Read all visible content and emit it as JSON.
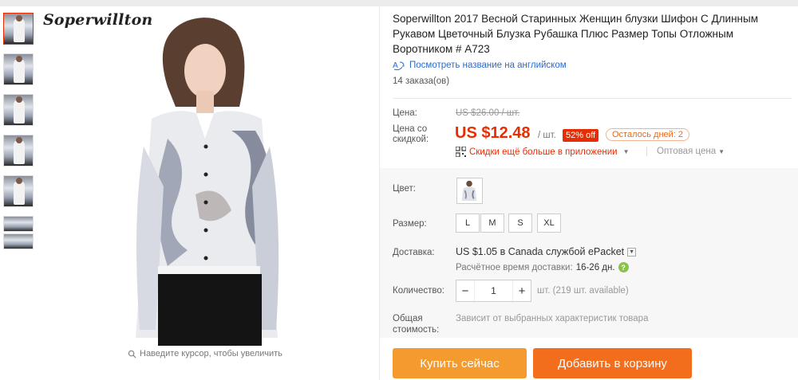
{
  "brand": "Soperwillton",
  "gallery": {
    "zoom_hint": "Наведите курсор, чтобы увеличить"
  },
  "product": {
    "title": "Soperwillton 2017 Весной Старинных Женщин блузки Шифон С Длинным Рукавом Цветочный Блузка Рубашка Плюс Размер Топы Отложным Воротником # A723",
    "translate_link": "Посмотреть название на английском",
    "orders": "14 заказа(ов)"
  },
  "price": {
    "price_label": "Цена:",
    "old_price": "US $26.00 / шт.",
    "discount_label": "Цена со скидкой:",
    "current_price": "US $12.48",
    "per_unit": "/ шт.",
    "off_badge": "52% off",
    "days_left": "Осталось дней: 2",
    "app_deals": "Скидки ещё больше в приложении",
    "wholesale": "Оптовая цена"
  },
  "options": {
    "color_label": "Цвет:",
    "size_label": "Размер:",
    "sizes": [
      "L",
      "M",
      "S",
      "XL"
    ],
    "shipping_label": "Доставка:",
    "shipping_price": "US $1.05 в Canada службой ePacket",
    "eta_label": "Расчётное время доставки:",
    "eta_days": "16-26 дн.",
    "qty_label": "Количество:",
    "qty_minus": "−",
    "qty_value": "1",
    "qty_plus": "+",
    "qty_available": "шт. (219 шт. available)",
    "total_label": "Общая стоимость:",
    "total_value": "Зависит от выбранных характеристик товара"
  },
  "actions": {
    "buy_now": "Купить сейчас",
    "add_to_cart": "Добавить в корзину"
  },
  "colors": {
    "price_red": "#e62e04",
    "buy_orange": "#f49a2f",
    "cart_orange": "#f26d1c",
    "link_blue": "#2a6bd0"
  }
}
